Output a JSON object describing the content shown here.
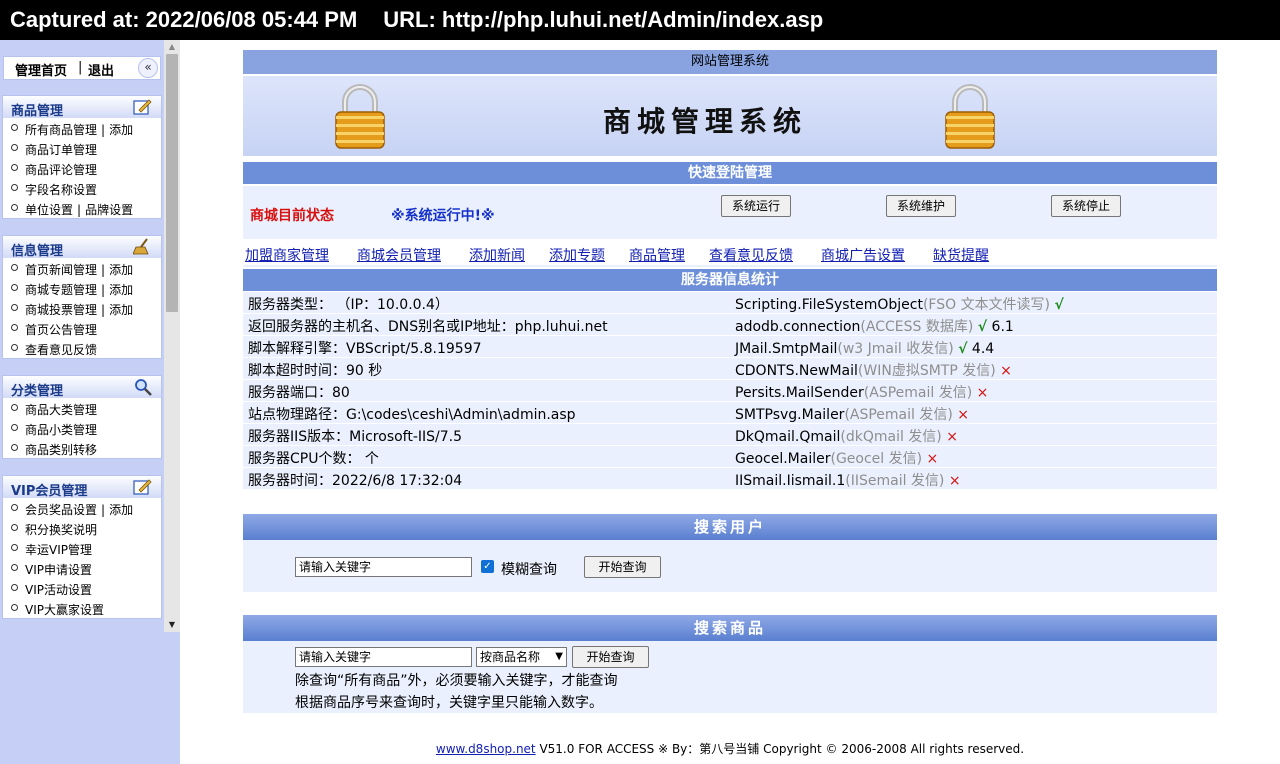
{
  "capture": {
    "captured_label": "Captured at: 2022/06/08 05:44 PM",
    "url_label": "URL: http://php.luhui.net/Admin/index.asp"
  },
  "left": {
    "home": "管理首页",
    "sep": "|",
    "exit": "退出",
    "collapse": "«",
    "groups": [
      {
        "title": "商品管理",
        "icon": "edit-icon",
        "items": [
          {
            "label": "所有商品管理",
            "extra": "添加"
          },
          {
            "label": "商品订单管理"
          },
          {
            "label": "商品评论管理"
          },
          {
            "label": "字段名称设置"
          },
          {
            "label": "单位设置",
            "extra": "品牌设置"
          }
        ]
      },
      {
        "title": "信息管理",
        "icon": "broom-icon",
        "items": [
          {
            "label": "首页新闻管理",
            "extra": "添加"
          },
          {
            "label": "商城专题管理",
            "extra": "添加"
          },
          {
            "label": "商城投票管理",
            "extra": "添加"
          },
          {
            "label": "首页公告管理"
          },
          {
            "label": "查看意见反馈"
          }
        ]
      },
      {
        "title": "分类管理",
        "icon": "magnifier-icon",
        "items": [
          {
            "label": "商品大类管理"
          },
          {
            "label": "商品小类管理"
          },
          {
            "label": "商品类别转移"
          }
        ]
      },
      {
        "title": "VIP会员管理",
        "icon": "edit-icon",
        "items": [
          {
            "label": "会员奖品设置",
            "extra": "添加"
          },
          {
            "label": "积分换奖说明"
          },
          {
            "label": "幸运VIP管理"
          },
          {
            "label": "VIP申请设置"
          },
          {
            "label": "VIP活动设置"
          },
          {
            "label": "VIP大赢家设置"
          }
        ]
      }
    ]
  },
  "main": {
    "sys_title": "网站管理系统",
    "banner_title": "商城管理系统",
    "quick_title": "快速登陆管理",
    "status_label": "商城目前状态",
    "status_value": "※系统运行中!※",
    "buttons": {
      "run": "系统运行",
      "maintain": "系统维护",
      "stop": "系统停止"
    },
    "links": [
      "加盟商家管理",
      "商城会员管理",
      "添加新闻",
      "添加专题",
      "商品管理",
      "查看意见反馈",
      "商城广告设置",
      "缺货提醒"
    ],
    "server_title": "服务器信息统计",
    "server_rows": [
      {
        "left": "服务器类型：  （IP：10.0.0.4）",
        "r_name": "Scripting.FileSystemObject",
        "r_desc": "(FSO 文本文件读写)",
        "r_mark": "√",
        "r_ok": true,
        "r_ver": ""
      },
      {
        "left": "返回服务器的主机名、DNS别名或IP地址：php.luhui.net",
        "r_name": "adodb.connection",
        "r_desc": "(ACCESS 数据库)",
        "r_mark": "√",
        "r_ok": true,
        "r_ver": "6.1"
      },
      {
        "left": "脚本解释引擎：VBScript/5.8.19597",
        "r_name": "JMail.SmtpMail",
        "r_desc": "(w3 Jmail 收发信)",
        "r_mark": "√",
        "r_ok": true,
        "r_ver": "4.4"
      },
      {
        "left": "脚本超时时间：90 秒",
        "r_name": "CDONTS.NewMail",
        "r_desc": "(WIN虚拟SMTP 发信)",
        "r_mark": "×",
        "r_ok": false,
        "r_ver": ""
      },
      {
        "left": "服务器端口：80",
        "r_name": "Persits.MailSender",
        "r_desc": "(ASPemail 发信)",
        "r_mark": "×",
        "r_ok": false,
        "r_ver": ""
      },
      {
        "left": "站点物理路径：G:\\codes\\ceshi\\Admin\\admin.asp",
        "r_name": "SMTPsvg.Mailer",
        "r_desc": "(ASPemail 发信)",
        "r_mark": "×",
        "r_ok": false,
        "r_ver": ""
      },
      {
        "left": "服务器IIS版本：Microsoft-IIS/7.5",
        "r_name": "DkQmail.Qmail",
        "r_desc": "(dkQmail 发信)",
        "r_mark": "×",
        "r_ok": false,
        "r_ver": ""
      },
      {
        "left": "服务器CPU个数： 个",
        "r_name": "Geocel.Mailer",
        "r_desc": "(Geocel 发信)",
        "r_mark": "×",
        "r_ok": false,
        "r_ver": ""
      },
      {
        "left": "服务器时间：2022/6/8 17:32:04",
        "r_name": "IISmail.Iismail.1",
        "r_desc": "(IISemail 发信)",
        "r_mark": "×",
        "r_ok": false,
        "r_ver": ""
      }
    ],
    "user_search": {
      "title": "搜索用户",
      "input_value": "请输入关键字",
      "fuzzy_label": "模糊查询",
      "fuzzy_checked": true,
      "check_mark": "✓",
      "submit": "开始查询"
    },
    "goods_search": {
      "title": "搜索商品",
      "input_value": "请输入关键字",
      "select_value": "按商品名称",
      "select_arrow": "▼",
      "submit": "开始查询",
      "note1": "除查询“所有商品”外，必须要输入关键字，才能查询",
      "note2": "根据商品序号来查询时，关键字里只能输入数字。"
    },
    "footer": {
      "link": "www.d8shop.net",
      "text": " V51.0 FOR ACCESS ※ By：第八号当铺 Copyright © 2006-2008 All rights reserved."
    }
  }
}
